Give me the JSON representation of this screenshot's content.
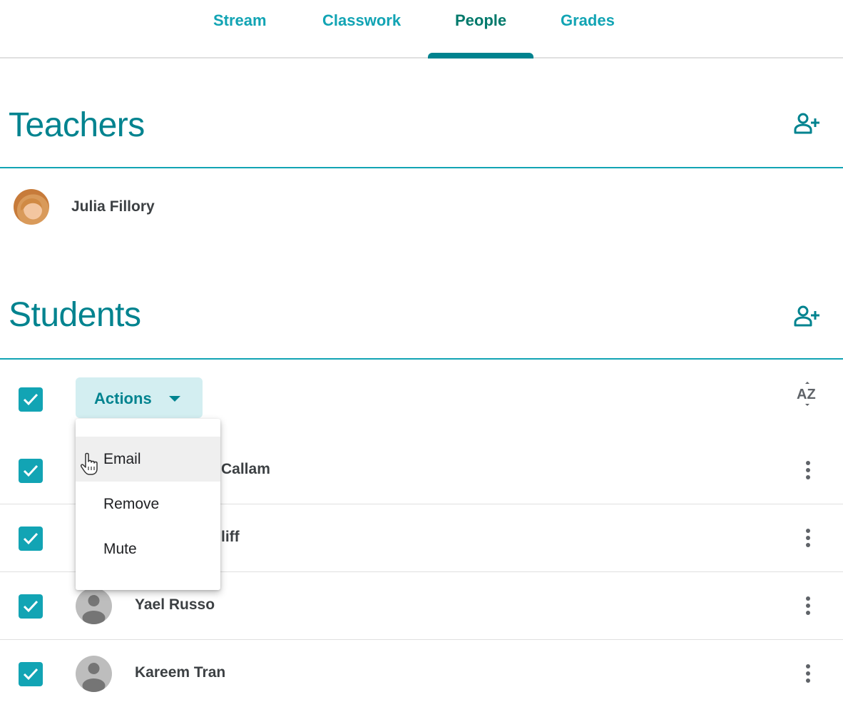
{
  "tabs": [
    {
      "label": "Stream",
      "active": false
    },
    {
      "label": "Classwork",
      "active": false
    },
    {
      "label": "People",
      "active": true
    },
    {
      "label": "Grades",
      "active": false
    }
  ],
  "teachers": {
    "title": "Teachers",
    "add_icon": "add-person-icon",
    "items": [
      {
        "name": "Julia Fillory",
        "avatar": "photo"
      }
    ]
  },
  "students": {
    "title": "Students",
    "add_icon": "add-person-icon",
    "select_all_checked": true,
    "actions_label": "Actions",
    "sort_icon": "sort-az-icon",
    "items": [
      {
        "name": "Callam",
        "visible_name_fragment": "Callam",
        "checked": true
      },
      {
        "name": "liff",
        "visible_name_fragment": "liff",
        "checked": true
      },
      {
        "name": "Yael Russo",
        "checked": true
      },
      {
        "name": "Kareem Tran",
        "checked": true
      }
    ]
  },
  "actions_menu": {
    "open": true,
    "items": [
      {
        "label": "Email",
        "hovered": true
      },
      {
        "label": "Remove",
        "hovered": false
      },
      {
        "label": "Mute",
        "hovered": false
      }
    ]
  },
  "colors": {
    "accent": "#12a4b4",
    "accent_dark": "#00838f",
    "actions_bg": "#d3eef1"
  }
}
